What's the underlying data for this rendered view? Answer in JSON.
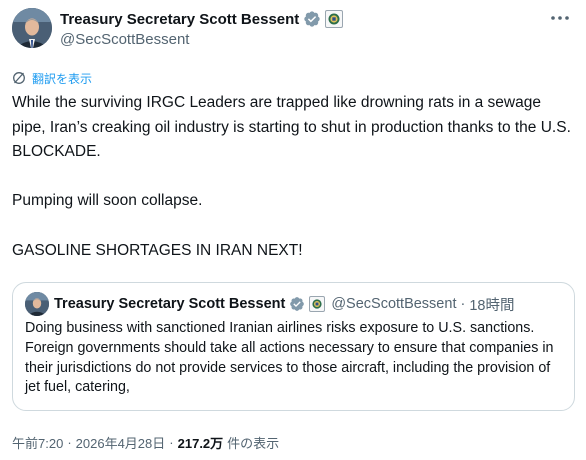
{
  "author": {
    "name": "Treasury Secretary Scott Bessent",
    "handle": "@SecScottBessent"
  },
  "translate_label": "翻訳を表示",
  "tweet_text": "While the surviving IRGC Leaders are trapped like drowning rats in a sewage pipe, Iran’s creaking oil industry is starting to shut in production thanks to the U.S. BLOCKADE.\n\nPumping will soon collapse.\n\nGASOLINE SHORTAGES IN IRAN NEXT!",
  "quote": {
    "name": "Treasury Secretary Scott Bessent",
    "handle": "@SecScottBessent",
    "separator": "·",
    "time": "18時間",
    "text": "Doing business with sanctioned Iranian airlines risks exposure to U.S. sanctions. Foreign governments should take all actions necessary to ensure that companies in their jurisdictions do not provide services to those aircraft, including the provision of jet fuel, catering,"
  },
  "meta": {
    "time": "午前7:20",
    "separator": "·",
    "date": "2026年4月28日",
    "views": "217.2万",
    "views_label": "件の表示"
  },
  "colors": {
    "accent": "#1d9bf0",
    "secondary_text": "#536471",
    "border": "#cfd9de"
  },
  "icons": {
    "verified": "verified-badge-icon",
    "affiliation": "treasury-seal-icon",
    "more": "more-options-icon",
    "translate": "translate-icon"
  }
}
